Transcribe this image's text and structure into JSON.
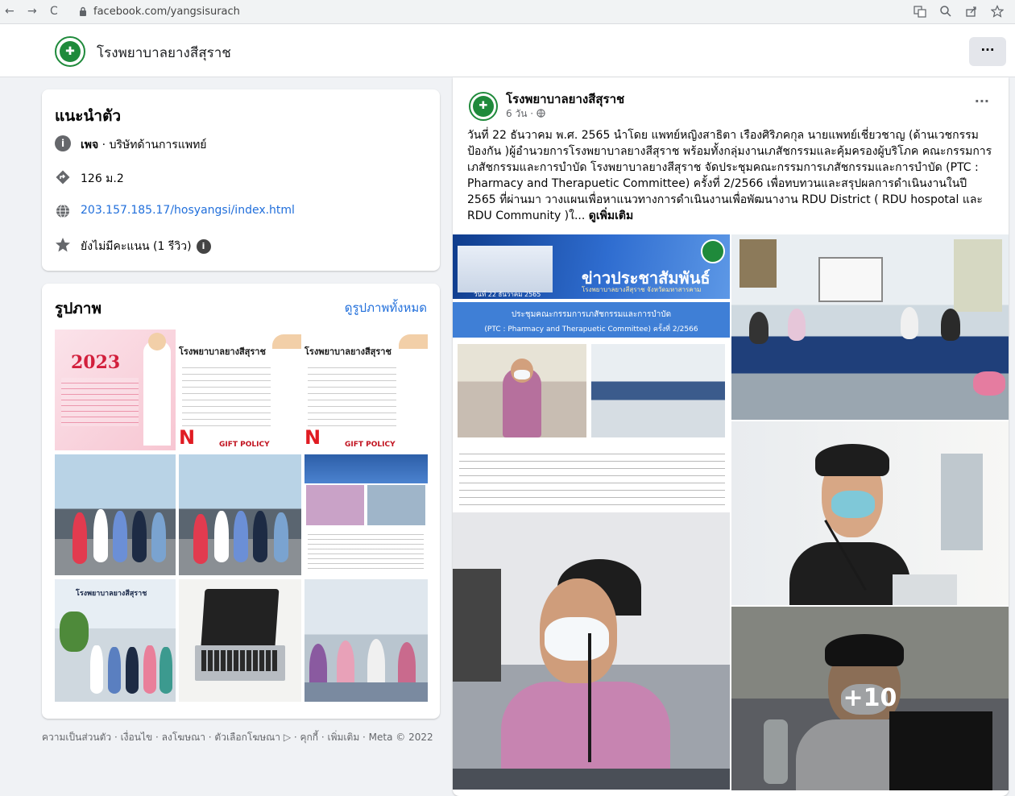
{
  "browser": {
    "back": "←",
    "forward": "→",
    "reload": "C",
    "url": "facebook.com/yangsisurach"
  },
  "page": {
    "name": "โรงพยาบาลยางสีสุราช",
    "more_label": "···"
  },
  "intro": {
    "title": "แนะนำตัว",
    "category_bold": "เพจ",
    "category_rest": " · บริษัทด้านการแพทย์",
    "address": "126 ม.2",
    "website": "203.157.185.17/hosyangsi/index.html",
    "rating": "ยังไม่มีคะแนน (1 รีวิว)"
  },
  "photos": {
    "title": "รูปภาพ",
    "see_all": "ดูรูปภาพทั้งหมด"
  },
  "footer": "ความเป็นส่วนตัว · เงื่อนไข · ลงโฆษณา · ตัวเลือกโฆษณา ▷ · คุกกี้ · เพิ่มเติม · Meta © 2022",
  "post": {
    "author": "โรงพยาบาลยางสีสุราช",
    "time": "6 วัน · ",
    "more_label": "···",
    "text": "วันที่ 22 ธันวาคม พ.ศ. 2565 นำโดย แพทย์หญิงสาธิตา เรืองศิริภคกุล นายแพทย์เชี่ยวชาญ (ด้านเวชกรรมป้องกัน )ผู้อำนวยการโรงพยาบาลยางสีสุราช พร้อมทั้งกลุ่มงานเภสัชกรรมและคุ้มครองผู้บริโภค คณะกรรมการเภสัชกรรมและการบำบัด โรงพยาบาลยางสีสุราช จัดประชุมคณะกรรมการเภสัชกรรมและการบำบัด (PTC : Pharmacy and Therapuetic Committee) ครั้งที่ 2/2566 เพื่อทบทวนและสรุปผลการดำเนินงานในปี 2565 ที่ผ่านมา วางแผนเพื่อหาแนวทางการดำเนินงานเพื่อพัฒนางาน RDU District ( RDU hospotal และ RDU Community )ใ...",
    "see_more": "ดูเพิ่มเติม",
    "extra_count": "+10"
  },
  "post_image_text": {
    "banner_title": "ข่าวประชาสัมพันธ์",
    "banner_sub": "โรงพยาบาลยางสีสุราช จังหวัดมหาสารคาม",
    "banner_date": "วันที่ 22 ธันวาคม 2565",
    "banner_line1": "ประชุมคณะกรรมการเภสัชกรรมและการบำบัด",
    "banner_line2": "(PTC : Pharmacy and Therapuetic Committee) ครั้งที่ 2/2566"
  },
  "thumb_text": {
    "newyear": "2023",
    "hospital": "โรงพยาบาลยางสีสุราช",
    "gift": "GIFT POLICY"
  },
  "colors": {
    "fb_blue": "#1877f2",
    "link": "#216fdb",
    "hospital_green": "#1f8a3b"
  }
}
